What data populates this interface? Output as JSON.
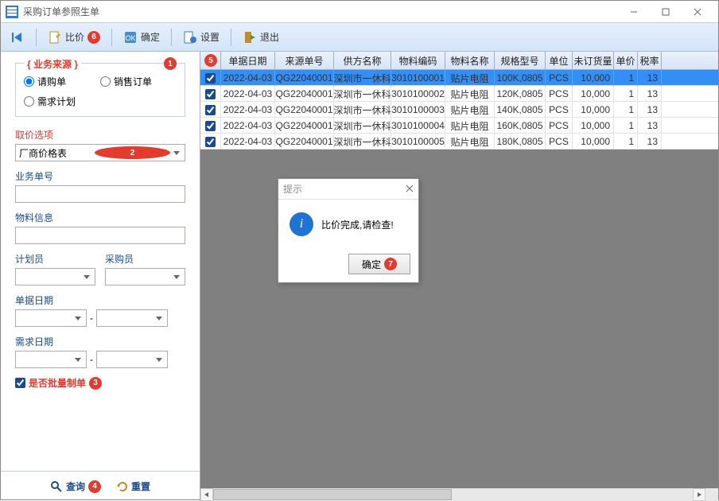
{
  "window": {
    "title": "采购订单参照生单"
  },
  "toolbar": {
    "first_icon": "first-record",
    "compare_label": "比价",
    "confirm_label": "确定",
    "settings_label": "设置",
    "exit_label": "退出"
  },
  "side": {
    "source_legend": "{ 业务来源 }",
    "radio_req": "请购单",
    "radio_sales": "销售订单",
    "radio_demand": "需求计划",
    "price_opt_label": "取价选项",
    "price_opt_value": "厂商价格表",
    "bizno_label": "业务单号",
    "bizno_value": "",
    "material_label": "物料信息",
    "material_value": "",
    "planner_label": "计划员",
    "buyer_label": "采购员",
    "billdate_label": "单据日期",
    "demanddate_label": "需求日期",
    "sep": "-",
    "batch_label": "是否批量制单",
    "query_label": "查询",
    "reset_label": "重置"
  },
  "grid": {
    "headers": [
      "",
      "单据日期",
      "来源单号",
      "供方名称",
      "物料编码",
      "物料名称",
      "规格型号",
      "单位",
      "未订货量",
      "单价",
      "税率"
    ],
    "rows": [
      {
        "date": "2022-04-03",
        "src": "QG22040001",
        "sup": "深圳市一休科",
        "mat": "3010100001",
        "matn": "贴片电阻",
        "spec": "100K,0805",
        "unit": "PCS",
        "qty": "10,000",
        "price": "1",
        "tax": "13"
      },
      {
        "date": "2022-04-03",
        "src": "QG22040001",
        "sup": "深圳市一休科",
        "mat": "3010100002",
        "matn": "贴片电阻",
        "spec": "120K,0805",
        "unit": "PCS",
        "qty": "10,000",
        "price": "1",
        "tax": "13"
      },
      {
        "date": "2022-04-03",
        "src": "QG22040001",
        "sup": "深圳市一休科",
        "mat": "3010100003",
        "matn": "贴片电阻",
        "spec": "140K,0805",
        "unit": "PCS",
        "qty": "10,000",
        "price": "1",
        "tax": "13"
      },
      {
        "date": "2022-04-03",
        "src": "QG22040001",
        "sup": "深圳市一休科",
        "mat": "3010100004",
        "matn": "贴片电阻",
        "spec": "160K,0805",
        "unit": "PCS",
        "qty": "10,000",
        "price": "1",
        "tax": "13"
      },
      {
        "date": "2022-04-03",
        "src": "QG22040001",
        "sup": "深圳市一休科",
        "mat": "3010100005",
        "matn": "贴片电阻",
        "spec": "180K,0805",
        "unit": "PCS",
        "qty": "10,000",
        "price": "1",
        "tax": "13"
      }
    ]
  },
  "dialog": {
    "title": "提示",
    "msg": "比价完成,请检查!",
    "ok": "确定"
  },
  "badges": {
    "b1": "1",
    "b2": "2",
    "b3": "3",
    "b4": "4",
    "b5": "5",
    "b6": "6",
    "b7": "7"
  }
}
